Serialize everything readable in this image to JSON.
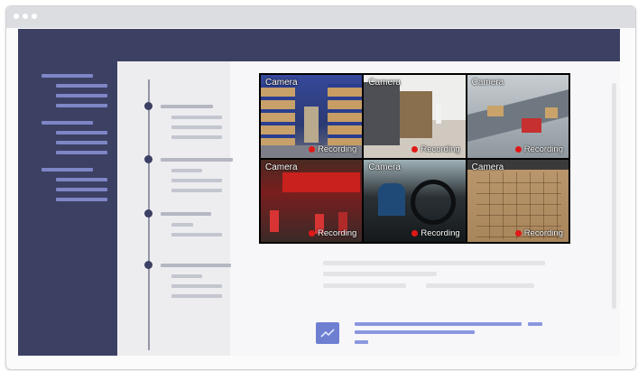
{
  "feeds": [
    {
      "camera_label": "Camera",
      "status_label": "Recording"
    },
    {
      "camera_label": "Camera",
      "status_label": "Recording"
    },
    {
      "camera_label": "Camera",
      "status_label": "Recording"
    },
    {
      "camera_label": "Camera",
      "status_label": "Recording"
    },
    {
      "camera_label": "Camera",
      "status_label": "Recording"
    },
    {
      "camera_label": "Camera",
      "status_label": "Recording"
    }
  ],
  "colors": {
    "navy": "#3c4063",
    "accent": "#6e7fd2",
    "recording_dot": "#e01818"
  },
  "icons": {
    "attachment": "image-icon"
  }
}
